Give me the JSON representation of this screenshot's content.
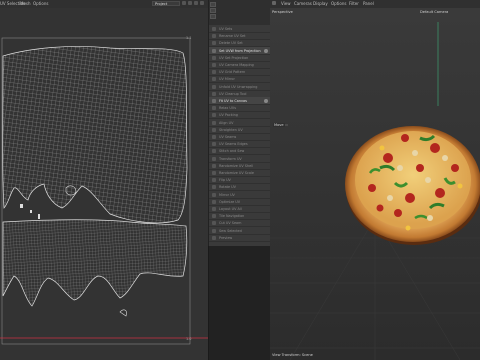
{
  "uv_editor": {
    "menu": [
      "UV Selection",
      "Mesh",
      "Options"
    ],
    "project_select": "Project",
    "marker_top": "1.1",
    "marker_bottom": "1.0"
  },
  "tool_panel": {
    "rows": [
      {
        "label": "UV Sets",
        "header": false
      },
      {
        "label": "Rename UV Set",
        "header": false
      },
      {
        "label": "Delete UV Set",
        "header": false
      },
      {
        "label": "Set UVW from Projection",
        "header": true
      },
      {
        "label": "UV Set Projection",
        "header": false
      },
      {
        "label": "UV Camera Mapping",
        "header": false
      },
      {
        "label": "UV Grid Pattern",
        "header": false
      },
      {
        "label": "UV Mirror",
        "header": false
      },
      {
        "label": "Unfold UV Unwrapping",
        "header": false
      },
      {
        "label": "UV Cleanup Tool",
        "header": false
      },
      {
        "label": "Fit UV to Canvas",
        "header": true
      },
      {
        "label": "Relax UVs",
        "header": false
      },
      {
        "label": "UV Packing",
        "header": false
      },
      {
        "label": "Align UV",
        "header": false
      },
      {
        "label": "Straighten UV",
        "header": false
      },
      {
        "label": "UV Seams",
        "header": false
      },
      {
        "label": "UV Seams Edges",
        "header": false
      },
      {
        "label": "Stitch and Sew",
        "header": false
      },
      {
        "label": "Transform UV",
        "header": false
      },
      {
        "label": "Randomize UV Shell",
        "header": false
      },
      {
        "label": "Randomize UV Scale",
        "header": false
      },
      {
        "label": "Flip UV",
        "header": false
      },
      {
        "label": "Rotate UV",
        "header": false
      },
      {
        "label": "Mirror UV",
        "header": false
      },
      {
        "label": "Optimize UV",
        "header": false
      },
      {
        "label": "Layout UV All",
        "header": false
      },
      {
        "label": "Tile Navigation",
        "header": false
      },
      {
        "label": "Cut UV Seam",
        "header": false
      },
      {
        "label": "Sew Selected",
        "header": false
      },
      {
        "label": "Preview",
        "header": false
      }
    ]
  },
  "viewport": {
    "menu": [
      "View",
      "Cameras",
      "Display",
      "Options",
      "Filter",
      "Panel"
    ],
    "view_name": "Perspective",
    "camera": "Default Camera",
    "move_label": "Move",
    "status": "View Transform: Scene"
  },
  "colors": {
    "accent": "#f0a030",
    "uv_line": "#e8e8e8",
    "uv_border": "#cc3344"
  }
}
